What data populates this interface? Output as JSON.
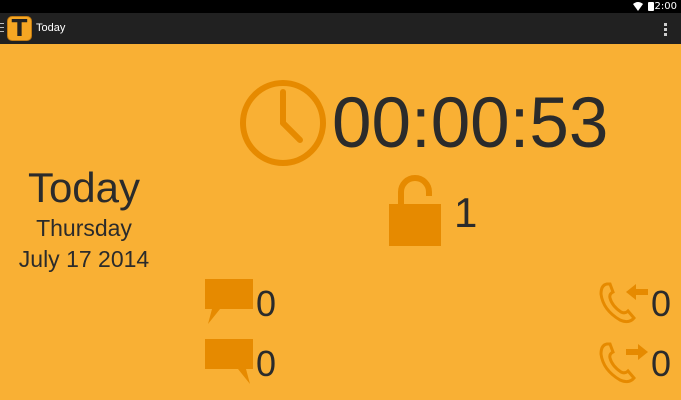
{
  "status_bar": {
    "time": "12:00"
  },
  "action_bar": {
    "app_icon_letter": "T",
    "title": "Today"
  },
  "date": {
    "title": "Today",
    "weekday": "Thursday",
    "full_date": "July 17 2014"
  },
  "stats": {
    "timer": "00:00:53",
    "unlocks": "1",
    "sms_received": "0",
    "sms_sent": "0",
    "calls_incoming": "0",
    "calls_outgoing": "0"
  },
  "colors": {
    "background": "#F9B034",
    "icon": "#E68A00",
    "text": "#2B2B2B",
    "action_bar": "#212121"
  },
  "icons": [
    "clock-icon",
    "unlock-icon",
    "sms-received-icon",
    "sms-sent-icon",
    "incoming-call-icon",
    "outgoing-call-icon",
    "overflow-menu-icon",
    "wifi-icon",
    "battery-icon"
  ]
}
